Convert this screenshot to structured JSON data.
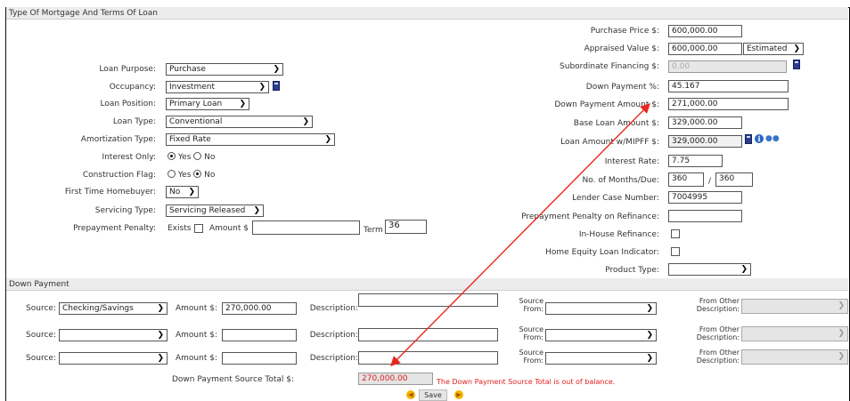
{
  "sections": {
    "terms_title": "Type Of Mortgage And Terms Of Loan",
    "down_payment_title": "Down Payment"
  },
  "left": {
    "loan_purpose": {
      "label": "Loan Purpose:",
      "value": "Purchase"
    },
    "occupancy": {
      "label": "Occupancy:",
      "value": "Investment"
    },
    "loan_position": {
      "label": "Loan Position:",
      "value": "Primary Loan"
    },
    "loan_type": {
      "label": "Loan Type:",
      "value": "Conventional"
    },
    "amortization_type": {
      "label": "Amortization Type:",
      "value": "Fixed Rate"
    },
    "interest_only": {
      "label": "Interest Only:",
      "yes": "Yes",
      "no": "No",
      "selected": "Yes"
    },
    "construction_flag": {
      "label": "Construction Flag:",
      "yes": "Yes",
      "no": "No",
      "selected": "No"
    },
    "first_time_homebuyer": {
      "label": "First Time Homebuyer:",
      "value": "No"
    },
    "servicing_type": {
      "label": "Servicing Type:",
      "value": "Servicing Released"
    },
    "prepayment_penalty": {
      "label": "Prepayment Penalty:",
      "exists": "Exists",
      "amount": "Amount $",
      "term": "Term",
      "term_value": "36"
    }
  },
  "right": {
    "purchase_price": {
      "label": "Purchase Price $:",
      "value": "600,000.00"
    },
    "appraised_value": {
      "label": "Appraised Value $:",
      "value": "600,000.00",
      "basis": "Estimated"
    },
    "subordinate_financing": {
      "label": "Subordinate Financing $:",
      "value": "0.00"
    },
    "down_payment_pct": {
      "label": "Down Payment %:",
      "value": "45.167"
    },
    "down_payment_amount": {
      "label": "Down Payment Amount $:",
      "value": "271,000.00"
    },
    "base_loan_amount": {
      "label": "Base Loan Amount $:",
      "value": "329,000.00"
    },
    "loan_amount_mipff": {
      "label": "Loan Amount w/MIPFF $:",
      "value": "329,000.00"
    },
    "interest_rate": {
      "label": "Interest Rate:",
      "value": "7.75"
    },
    "months_due": {
      "label": "No. of Months/Due:",
      "months": "360",
      "sep": "/",
      "due": "360"
    },
    "lender_case_number": {
      "label": "Lender Case Number:",
      "value": "7004995"
    },
    "prepayment_refinance": {
      "label": "Prepayment Penalty on Refinance:",
      "value": ""
    },
    "in_house_refinance": {
      "label": "In-House Refinance:"
    },
    "home_equity_indicator": {
      "label": "Home Equity Loan Indicator:"
    },
    "product_type": {
      "label": "Product Type:",
      "value": ""
    }
  },
  "down_payment": {
    "source_label": "Source:",
    "amount_label": "Amount $:",
    "description_label": "Description:",
    "source_from_label_1": "Source",
    "source_from_label_2": "From:",
    "other_desc_label_1": "From Other",
    "other_desc_label_2": "Description:",
    "rows": [
      {
        "source": "Checking/Savings",
        "amount": "270,000.00",
        "description": "",
        "source_from": ""
      },
      {
        "source": "",
        "amount": "",
        "description": "",
        "source_from": ""
      },
      {
        "source": "",
        "amount": "",
        "description": "",
        "source_from": ""
      }
    ],
    "total_label": "Down Payment Source Total $:",
    "total_value": "270,000.00",
    "error": "The Down Payment Source Total is out of balance.",
    "save": "Save"
  },
  "colors": {
    "annotation_arrow": "#e8281f",
    "error_text": "#e02020"
  }
}
